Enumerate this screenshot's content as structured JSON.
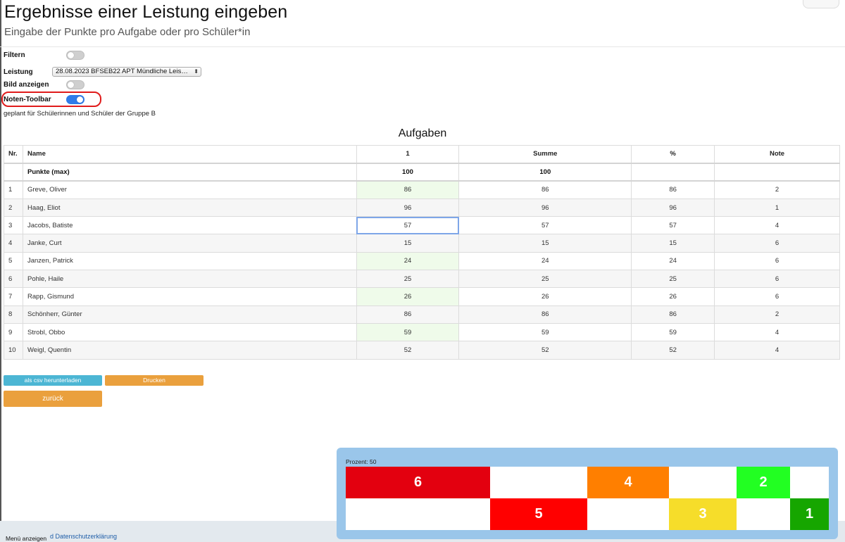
{
  "page": {
    "title": "Ergebnisse einer Leistung eingeben",
    "subtitle": "Eingabe der Punkte pro Aufgabe oder pro Schüler*in"
  },
  "filters": {
    "filter_label": "Filtern",
    "filter_on": false,
    "leistung_label": "Leistung",
    "leistung_value": "28.08.2023 BFSEB22 APT Mündliche Leis…",
    "bild_label": "Bild anzeigen",
    "bild_on": false,
    "toolbar_label": "Noten-Toolbar",
    "toolbar_on": true
  },
  "info_text": "geplant für Schülerinnen und Schüler der Gruppe B",
  "table": {
    "title": "Aufgaben",
    "columns": [
      "Nr.",
      "Name",
      "1",
      "Summe",
      "%",
      "Note"
    ],
    "max_row": {
      "label": "Punkte (max)",
      "task1": "100",
      "sum": "100"
    },
    "rows": [
      {
        "nr": "1",
        "name": "Greve, Oliver",
        "task1": "86",
        "sum": "86",
        "pct": "86",
        "note": "2"
      },
      {
        "nr": "2",
        "name": "Haag, Eliot",
        "task1": "96",
        "sum": "96",
        "pct": "96",
        "note": "1"
      },
      {
        "nr": "3",
        "name": "Jacobs, Batiste",
        "task1": "57",
        "sum": "57",
        "pct": "57",
        "note": "4"
      },
      {
        "nr": "4",
        "name": "Janke, Curt",
        "task1": "15",
        "sum": "15",
        "pct": "15",
        "note": "6"
      },
      {
        "nr": "5",
        "name": "Janzen, Patrick",
        "task1": "24",
        "sum": "24",
        "pct": "24",
        "note": "6"
      },
      {
        "nr": "6",
        "name": "Pohle, Haile",
        "task1": "25",
        "sum": "25",
        "pct": "25",
        "note": "6"
      },
      {
        "nr": "7",
        "name": "Rapp, Gismund",
        "task1": "26",
        "sum": "26",
        "pct": "26",
        "note": "6"
      },
      {
        "nr": "8",
        "name": "Schönherr, Günter",
        "task1": "86",
        "sum": "86",
        "pct": "86",
        "note": "2"
      },
      {
        "nr": "9",
        "name": "Strobl, Obbo",
        "task1": "59",
        "sum": "59",
        "pct": "59",
        "note": "4"
      },
      {
        "nr": "10",
        "name": "Weigl, Quentin",
        "task1": "52",
        "sum": "52",
        "pct": "52",
        "note": "4"
      }
    ]
  },
  "buttons": {
    "csv": "als csv herunterladen",
    "print": "Drucken",
    "back": "zurück"
  },
  "footer": {
    "menu": "Menü anzeigen",
    "privacy": "d Datenschutzerklärung"
  },
  "grade_toolbar": {
    "percent_label": "Prozent: 50",
    "grades": [
      {
        "label": "6",
        "color": "#e3000f"
      },
      {
        "label": "5",
        "color": "#ff0000"
      },
      {
        "label": "4",
        "color": "#ff7f00"
      },
      {
        "label": "3",
        "color": "#f6dd2a"
      },
      {
        "label": "2",
        "color": "#22ff22"
      },
      {
        "label": "1",
        "color": "#16a600"
      }
    ]
  },
  "colors": {
    "accent_blue": "#2f7be9",
    "highlight_red": "#e01b1b",
    "csv_button": "#4cb6d4",
    "orange_button": "#eaa03d",
    "toolbar_bg": "#9ac6ea"
  }
}
